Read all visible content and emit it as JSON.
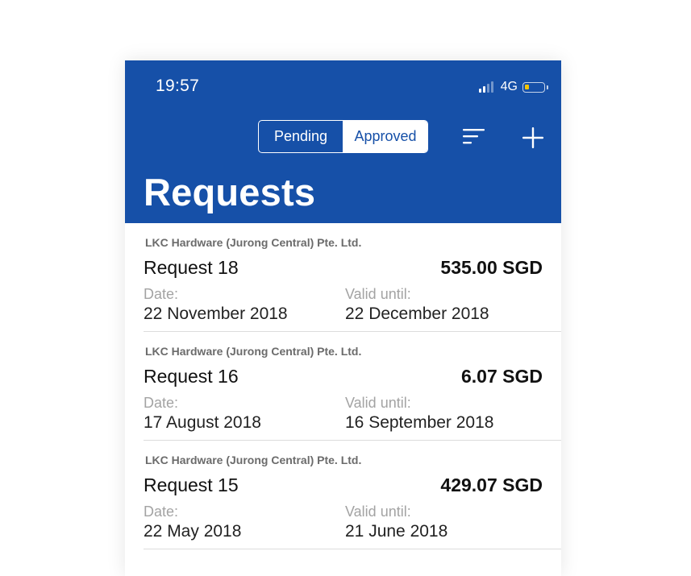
{
  "status_bar": {
    "time": "19:57",
    "network": "4G",
    "signal_bars": 4,
    "signal_active_bars": 2,
    "battery_level": 0.25,
    "battery_color": "#f5c400"
  },
  "colors": {
    "header_bg": "#1650a8",
    "header_text": "#ffffff",
    "vendor_text": "#6b6b6b",
    "label_text": "#a3a3a3"
  },
  "toolbar": {
    "segments": [
      {
        "label": "Pending",
        "selected": false
      },
      {
        "label": "Approved",
        "selected": true
      }
    ],
    "sort_icon": "sort-lines-icon",
    "add_icon": "plus-icon"
  },
  "page_title": "Requests",
  "requests": [
    {
      "vendor": "LKC Hardware (Jurong Central) Pte. Ltd.",
      "name": "Request 18",
      "amount": "535.00 SGD",
      "date_label": "Date:",
      "date": "22 November 2018",
      "valid_label": "Valid until:",
      "valid_until": "22 December 2018"
    },
    {
      "vendor": "LKC Hardware (Jurong Central) Pte. Ltd.",
      "name": "Request 16",
      "amount": "6.07 SGD",
      "date_label": "Date:",
      "date": "17 August 2018",
      "valid_label": "Valid until:",
      "valid_until": "16 September 2018"
    },
    {
      "vendor": "LKC Hardware (Jurong Central) Pte. Ltd.",
      "name": "Request 15",
      "amount": "429.07 SGD",
      "date_label": "Date:",
      "date": "22 May 2018",
      "valid_label": "Valid until:",
      "valid_until": "21 June 2018"
    }
  ]
}
